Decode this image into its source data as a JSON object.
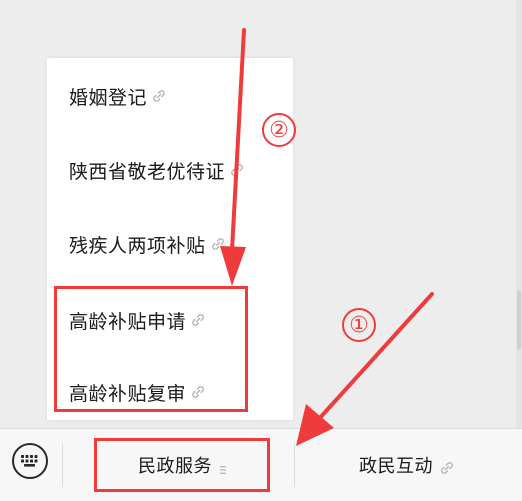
{
  "submenu": {
    "items": [
      {
        "label": "婚姻登记"
      },
      {
        "label": "陕西省敬老优待证"
      },
      {
        "label": "残疾人两项补贴"
      },
      {
        "label": "高龄补贴申请"
      },
      {
        "label": "高龄补贴复审"
      }
    ]
  },
  "bottom_bar": {
    "menus": [
      {
        "label": "民政服务"
      },
      {
        "label": "政民互动"
      }
    ]
  },
  "annotations": {
    "step1": "①",
    "step2": "②",
    "color": "#ef3b3b"
  }
}
